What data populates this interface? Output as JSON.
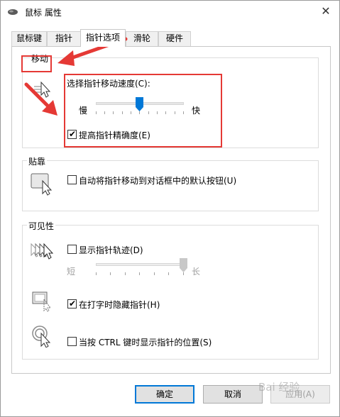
{
  "window": {
    "title": "鼠标 属性",
    "close_glyph": "✕"
  },
  "tabs": [
    {
      "label": "鼠标键",
      "active": false
    },
    {
      "label": "指针",
      "active": false
    },
    {
      "label": "指针选项",
      "active": true
    },
    {
      "label": "滑轮",
      "active": false
    },
    {
      "label": "硬件",
      "active": false
    }
  ],
  "motion": {
    "heading": "移动",
    "speed_label": "选择指针移动速度(C):",
    "slow": "慢",
    "fast": "快",
    "speed_value_fraction": 0.5,
    "precision_label": "提高指针精确度(E)",
    "precision_checked": true
  },
  "snap": {
    "heading": "贴靠",
    "snap_label": "自动将指针移动到对话框中的默认按钮(U)",
    "snap_checked": false
  },
  "visibility": {
    "heading": "可见性",
    "trails_label": "显示指针轨迹(D)",
    "trails_checked": false,
    "short": "短",
    "long": "长",
    "trails_value_fraction": 1.0,
    "hide_label": "在打字时隐藏指针(H)",
    "hide_checked": true,
    "ctrl_label": "当按 CTRL 键时显示指针的位置(S)",
    "ctrl_checked": false
  },
  "buttons": {
    "ok": "确定",
    "cancel": "取消",
    "apply": "应用(A)"
  },
  "watermark": "Bai 经验",
  "colors": {
    "annotation": "#e53935",
    "accent": "#0078d7",
    "slider_thumb": "#0078d7"
  },
  "icons": {
    "title": "mouse-icon",
    "motion": "pointer-speed-icon",
    "snap": "snap-to-button-icon",
    "trails": "pointer-trails-icon",
    "hide": "hide-pointer-icon",
    "ctrl": "locate-pointer-icon"
  }
}
